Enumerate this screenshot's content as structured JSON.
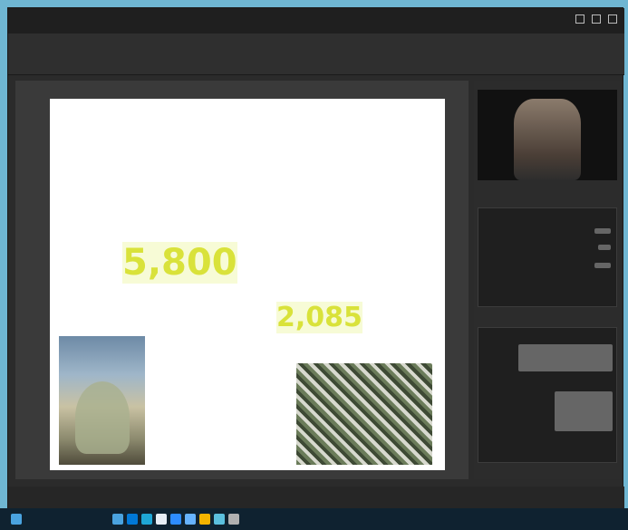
{
  "window": {
    "meeting_title": "",
    "status": ""
  },
  "slide": {
    "title": "",
    "caption_top": "",
    "big_number_1": "5,800",
    "big_number_2": "2,085",
    "big_number_3": "",
    "big_number_4": "",
    "caption_bottom": ""
  },
  "sidebar": {
    "participant_label": "",
    "panel1_title": "",
    "panel2_title": ""
  },
  "taskbar": {
    "time": ""
  },
  "colors": {
    "accent_yellow": "#d9e23a",
    "window_bg": "#2b2b2b",
    "taskbar_bg": "#0f2230"
  }
}
